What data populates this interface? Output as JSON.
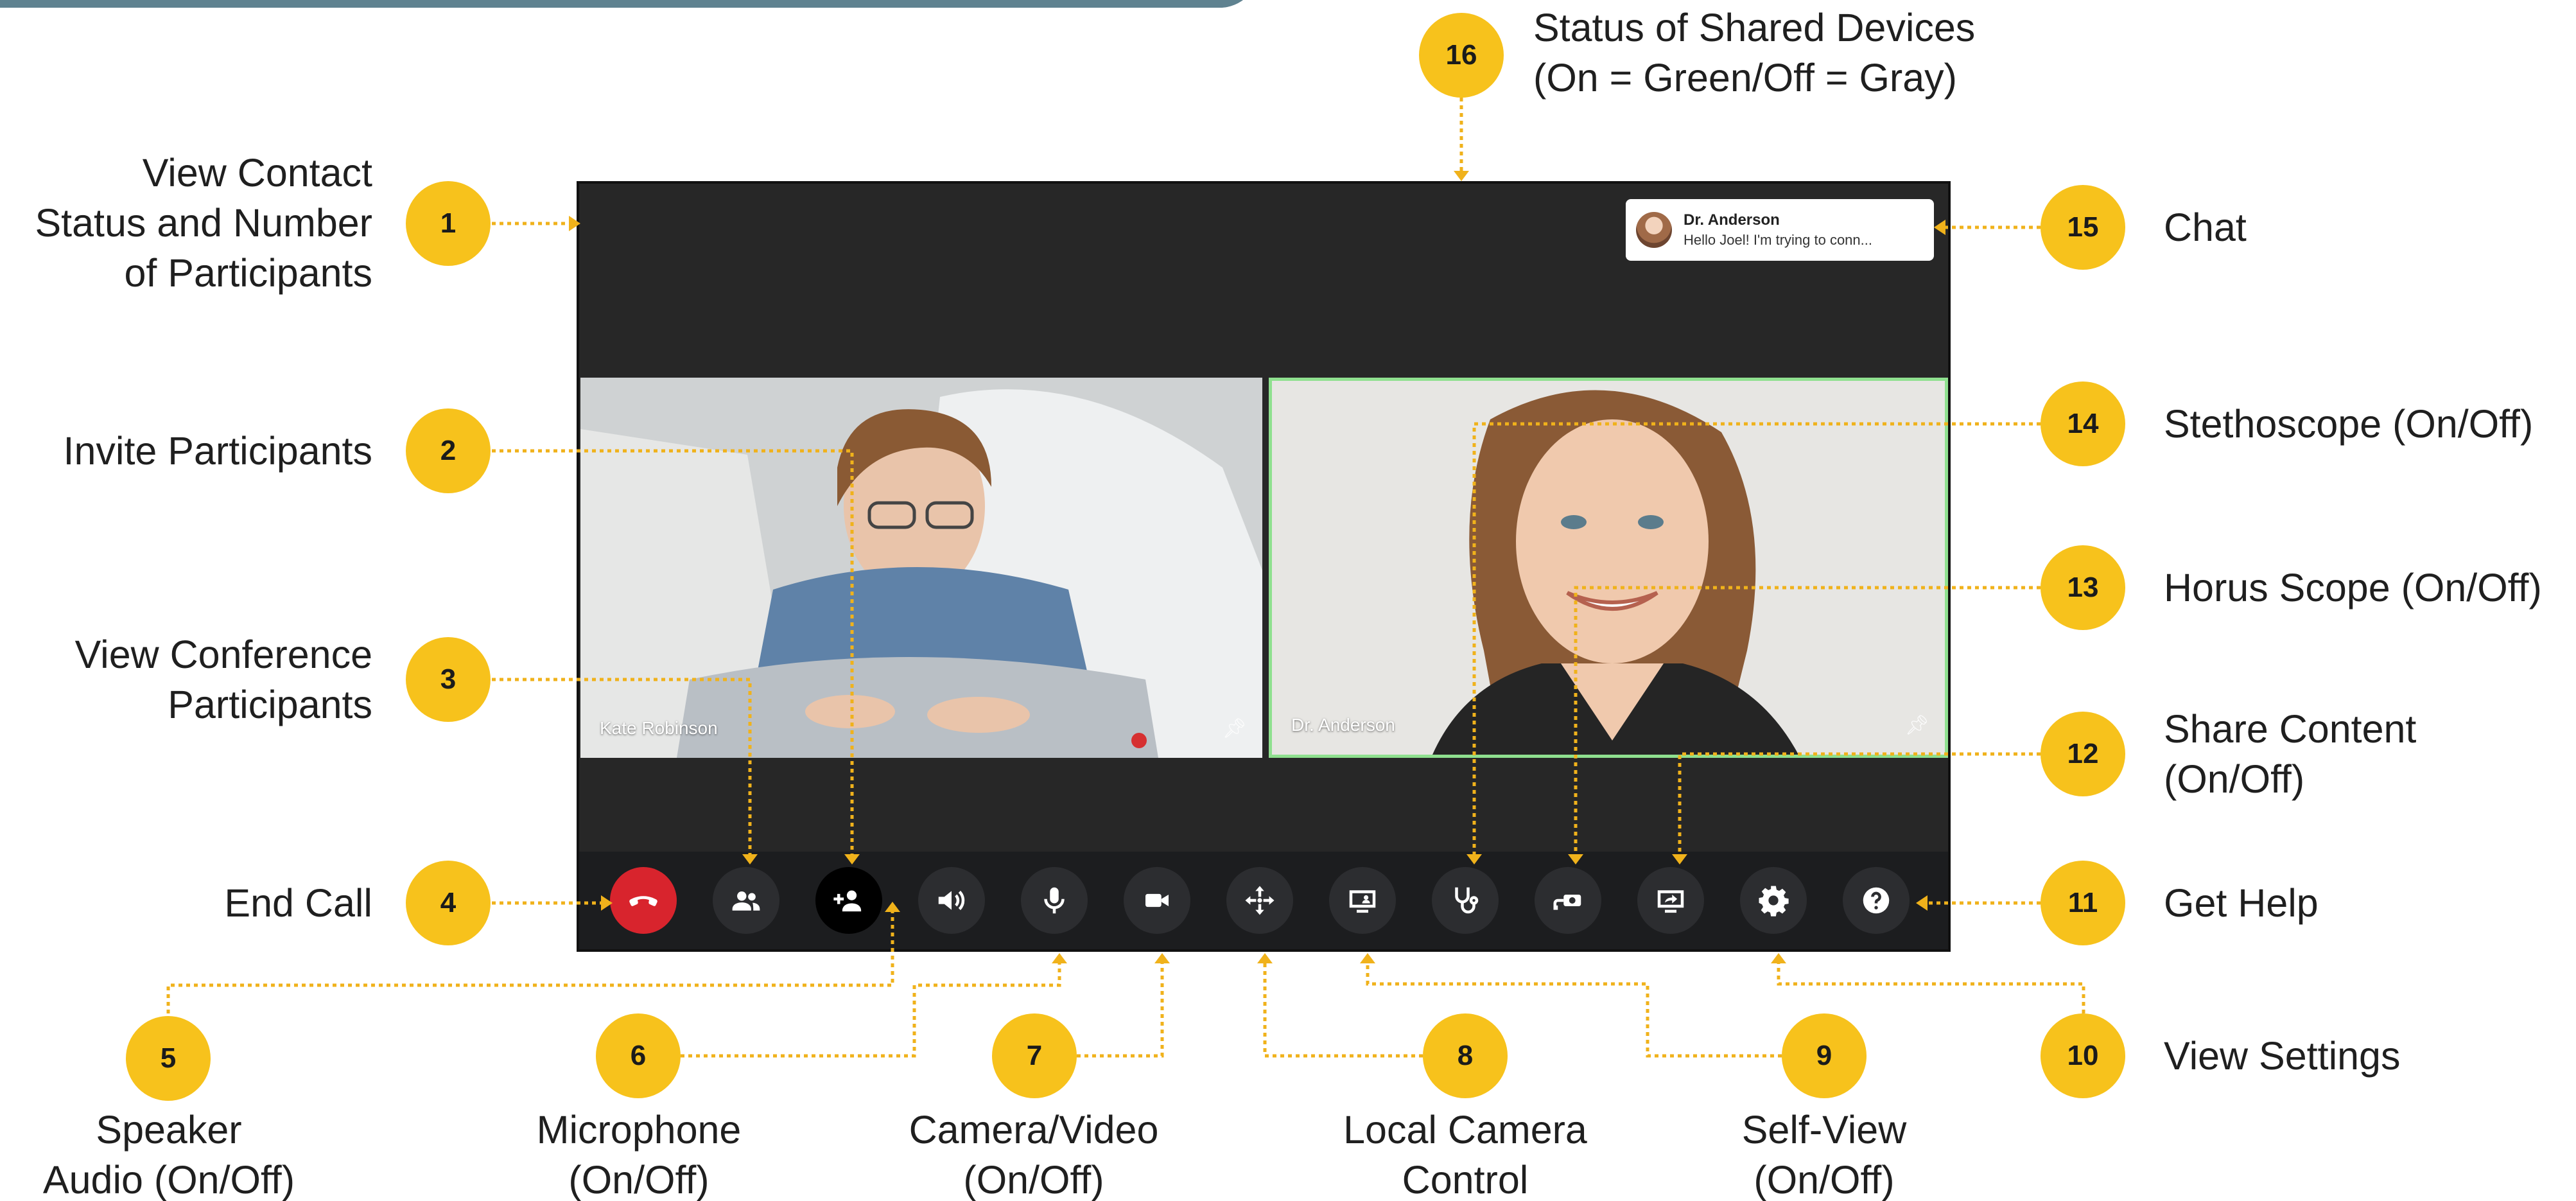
{
  "screen": {
    "chat": {
      "sender": "Dr. Anderson",
      "message": "Hello Joel! I'm trying to conn..."
    },
    "videos": [
      {
        "name": "Kate Robinson",
        "pinned": true
      },
      {
        "name": "Dr. Anderson",
        "pinned": true,
        "highlight_color": "#8fe08f"
      }
    ],
    "controls": [
      {
        "id": "end-call",
        "icon": "phone-hangup-icon",
        "color": "#d8242d"
      },
      {
        "id": "participants",
        "icon": "people-icon"
      },
      {
        "id": "invite",
        "icon": "add-person-icon",
        "color": "#000000"
      },
      {
        "id": "speaker",
        "icon": "speaker-icon"
      },
      {
        "id": "microphone",
        "icon": "microphone-icon"
      },
      {
        "id": "camera",
        "icon": "video-camera-icon"
      },
      {
        "id": "camera-control",
        "icon": "move-arrows-icon"
      },
      {
        "id": "self-view",
        "icon": "monitor-person-icon"
      },
      {
        "id": "stethoscope",
        "icon": "stethoscope-icon"
      },
      {
        "id": "horus-scope",
        "icon": "scope-camera-icon"
      },
      {
        "id": "share-content",
        "icon": "share-screen-icon"
      },
      {
        "id": "settings",
        "icon": "gear-icon"
      },
      {
        "id": "help",
        "icon": "help-icon"
      }
    ]
  },
  "callouts": [
    {
      "n": "1",
      "lines": [
        "View Contact",
        "Status and Number",
        "of Participants"
      ]
    },
    {
      "n": "2",
      "lines": [
        "Invite Participants"
      ]
    },
    {
      "n": "3",
      "lines": [
        "View Conference",
        "Participants"
      ]
    },
    {
      "n": "4",
      "lines": [
        "End Call"
      ]
    },
    {
      "n": "5",
      "lines": [
        "Speaker",
        "Audio (On/Off)"
      ]
    },
    {
      "n": "6",
      "lines": [
        "Microphone",
        "(On/Off)"
      ]
    },
    {
      "n": "7",
      "lines": [
        "Camera/Video",
        "(On/Off)"
      ]
    },
    {
      "n": "8",
      "lines": [
        "Local Camera",
        "Control"
      ]
    },
    {
      "n": "9",
      "lines": [
        "Self-View",
        "(On/Off)"
      ]
    },
    {
      "n": "10",
      "lines": [
        "View Settings"
      ]
    },
    {
      "n": "11",
      "lines": [
        "Get Help"
      ]
    },
    {
      "n": "12",
      "lines": [
        "Share Content",
        "(On/Off)"
      ]
    },
    {
      "n": "13",
      "lines": [
        "Horus Scope (On/Off)"
      ]
    },
    {
      "n": "14",
      "lines": [
        "Stethoscope (On/Off)"
      ]
    },
    {
      "n": "15",
      "lines": [
        "Chat"
      ]
    },
    {
      "n": "16",
      "lines": [
        "Status of Shared Devices",
        "(On = Green/Off = Gray)"
      ]
    }
  ],
  "colors": {
    "badge": "#f7c21c",
    "leader": "#f0b21b",
    "end_call": "#d8242d",
    "active_border": "#8fe08f"
  }
}
